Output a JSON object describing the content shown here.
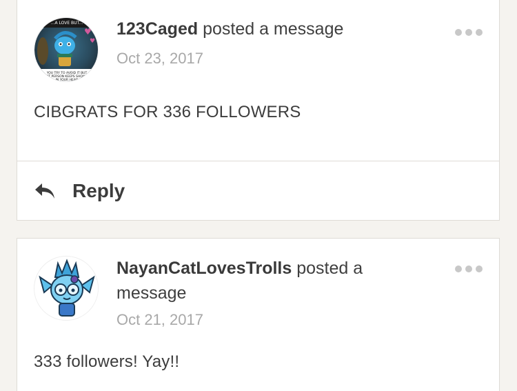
{
  "posts": [
    {
      "username": "123Caged",
      "action": "posted a message",
      "date": "Oct 23, 2017",
      "message": "CIBGRATS FOR 336 FOLLOWERS",
      "avatar_caption_top": "...A LOVE BUT...",
      "avatar_caption_bottom": "YOU TRY TO AVOID IT BUT THAT PERSON KEEPS SHOWING IN YOUR HEAD",
      "more_icon": "more-horizontal-icon",
      "reply_label": "Reply",
      "reply_icon": "reply-arrow-icon"
    },
    {
      "username": "NayanCatLovesTrolls",
      "action": "posted a message",
      "date": "Oct 21, 2017",
      "message": "333 followers! Yay!!",
      "more_icon": "more-horizontal-icon"
    }
  ],
  "colors": {
    "background": "#f5f3ef",
    "card": "#ffffff",
    "border": "#dedbd6",
    "text": "#3c3c3c",
    "date": "#a8a8a8",
    "dots": "#c8c8c8"
  }
}
